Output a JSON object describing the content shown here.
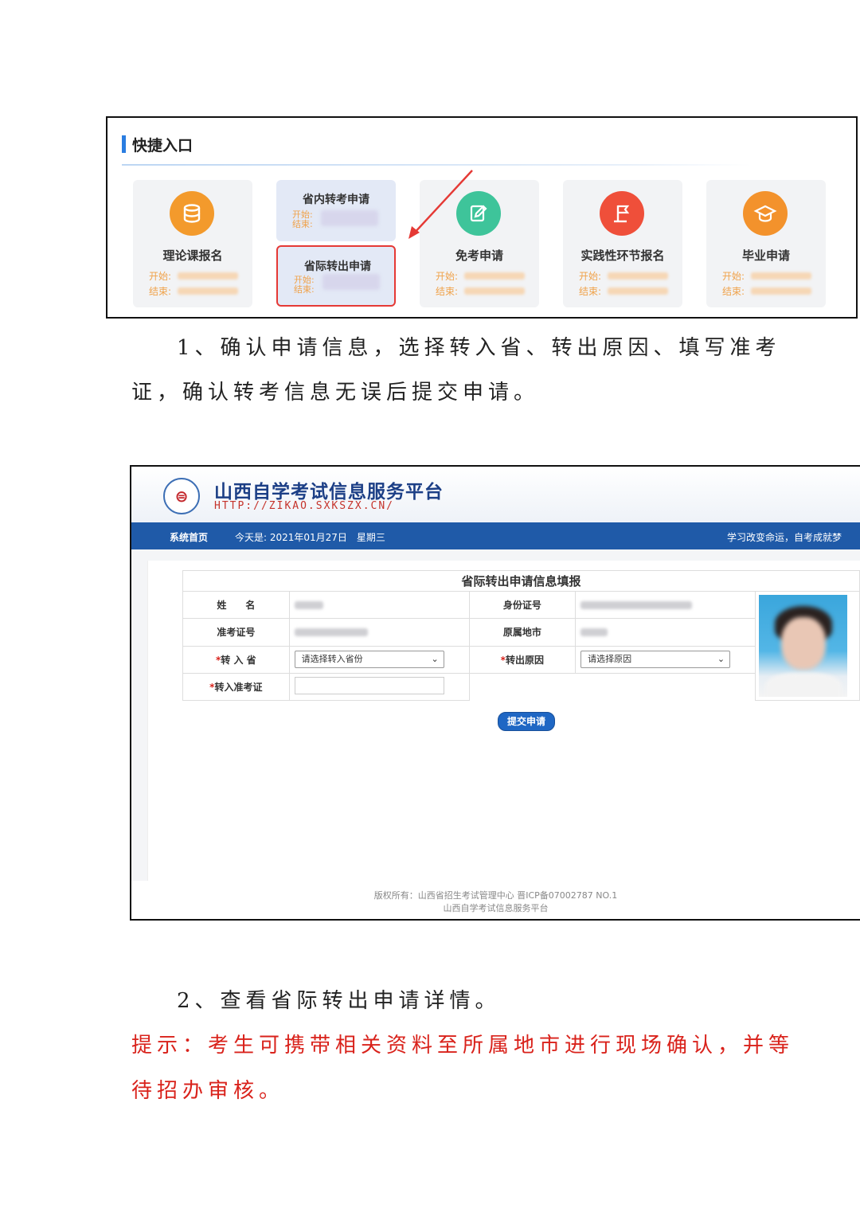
{
  "quick_entry": {
    "title": "快捷入口",
    "cards": [
      {
        "label": "理论课报名",
        "icon": "database-icon",
        "color": "#f39a2c",
        "start_label": "开始:",
        "end_label": "结束:"
      },
      {
        "sub_items": [
          {
            "label": "省内转考申请",
            "start_label": "开始:",
            "end_label": "结束:"
          },
          {
            "label": "省际转出申请",
            "start_label": "开始:",
            "end_label": "结束:"
          }
        ]
      },
      {
        "label": "免考申请",
        "icon": "edit-icon",
        "color": "#3ec49a",
        "start_label": "开始:",
        "end_label": "结束:"
      },
      {
        "label": "实践性环节报名",
        "icon": "flag-icon",
        "color": "#ef4f3a",
        "start_label": "开始:",
        "end_label": "结束:"
      },
      {
        "label": "毕业申请",
        "icon": "graduation-cap-icon",
        "color": "#f3922c",
        "start_label": "开始:",
        "end_label": "结束:"
      }
    ],
    "highlight_color": "#e53935"
  },
  "text": {
    "step1_line1": "1、确认申请信息，选择转入省、转出原因、填写准考",
    "step1_line2": "证，确认转考信息无误后提交申请。",
    "step2": "2、查看省际转出申请详情。",
    "tip_line1": "提示：考生可携带相关资料至所属地市进行现场确认，并等",
    "tip_line2": "待招办审核。"
  },
  "portal": {
    "site_title": "山西自学考试信息服务平台",
    "site_url": "HTTP://ZIKAO.SXKSZX.CN/",
    "nav_home": "系统首页",
    "nav_date": "今天是: 2021年01月27日　星期三",
    "nav_slogan": "学习改变命运，自考成就梦",
    "form": {
      "title": "省际转出申请信息填报",
      "name_label": "姓　　名",
      "id_label": "身份证号",
      "exam_no_label": "准考证号",
      "city_label": "原属地市",
      "to_province_label": "转 入 省",
      "reason_label": "转出原因",
      "new_exam_no_label": "转入准考证",
      "to_province_placeholder": "请选择转入省份",
      "reason_placeholder": "请选择原因",
      "submit": "提交申请"
    },
    "footer_line1": "版权所有：山西省招生考试管理中心 晋ICP备07002787 NO.1",
    "footer_line2": "山西自学考试信息服务平台",
    "brand_color": "#1f5aa8"
  }
}
